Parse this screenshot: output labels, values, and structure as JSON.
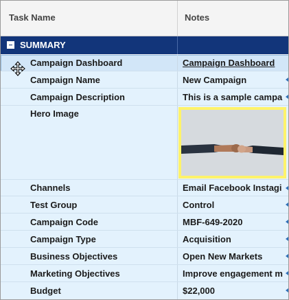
{
  "header": {
    "col_task": "Task Name",
    "col_notes": "Notes"
  },
  "summary": {
    "label": "SUMMARY"
  },
  "rows": [
    {
      "name": "Campaign Dashboard",
      "value": "Campaign Dashboard"
    },
    {
      "name": "Campaign Name",
      "value": "New Campaign"
    },
    {
      "name": "Campaign Description",
      "value": "This is a sample campa"
    },
    {
      "name": "Hero Image",
      "value": ""
    },
    {
      "name": "Channels",
      "value": "Email Facebook Instagi"
    },
    {
      "name": "Test Group",
      "value": "Control"
    },
    {
      "name": "Campaign Code",
      "value": "MBF-649-2020"
    },
    {
      "name": "Campaign Type",
      "value": "Acquisition"
    },
    {
      "name": "Business Objectives",
      "value": "Open New Markets"
    },
    {
      "name": "Marketing Objectives",
      "value": "Improve engagement m"
    },
    {
      "name": "Budget",
      "value": "$22,000"
    }
  ],
  "colors": {
    "summary_bg": "#12357a",
    "row_bg": "#e3f2fd",
    "link": "#1a3fb5",
    "hero_border": "#fff36a"
  },
  "icons": [
    "move-cursor-icon",
    "collapse-icon",
    "expand-caret-icon"
  ]
}
